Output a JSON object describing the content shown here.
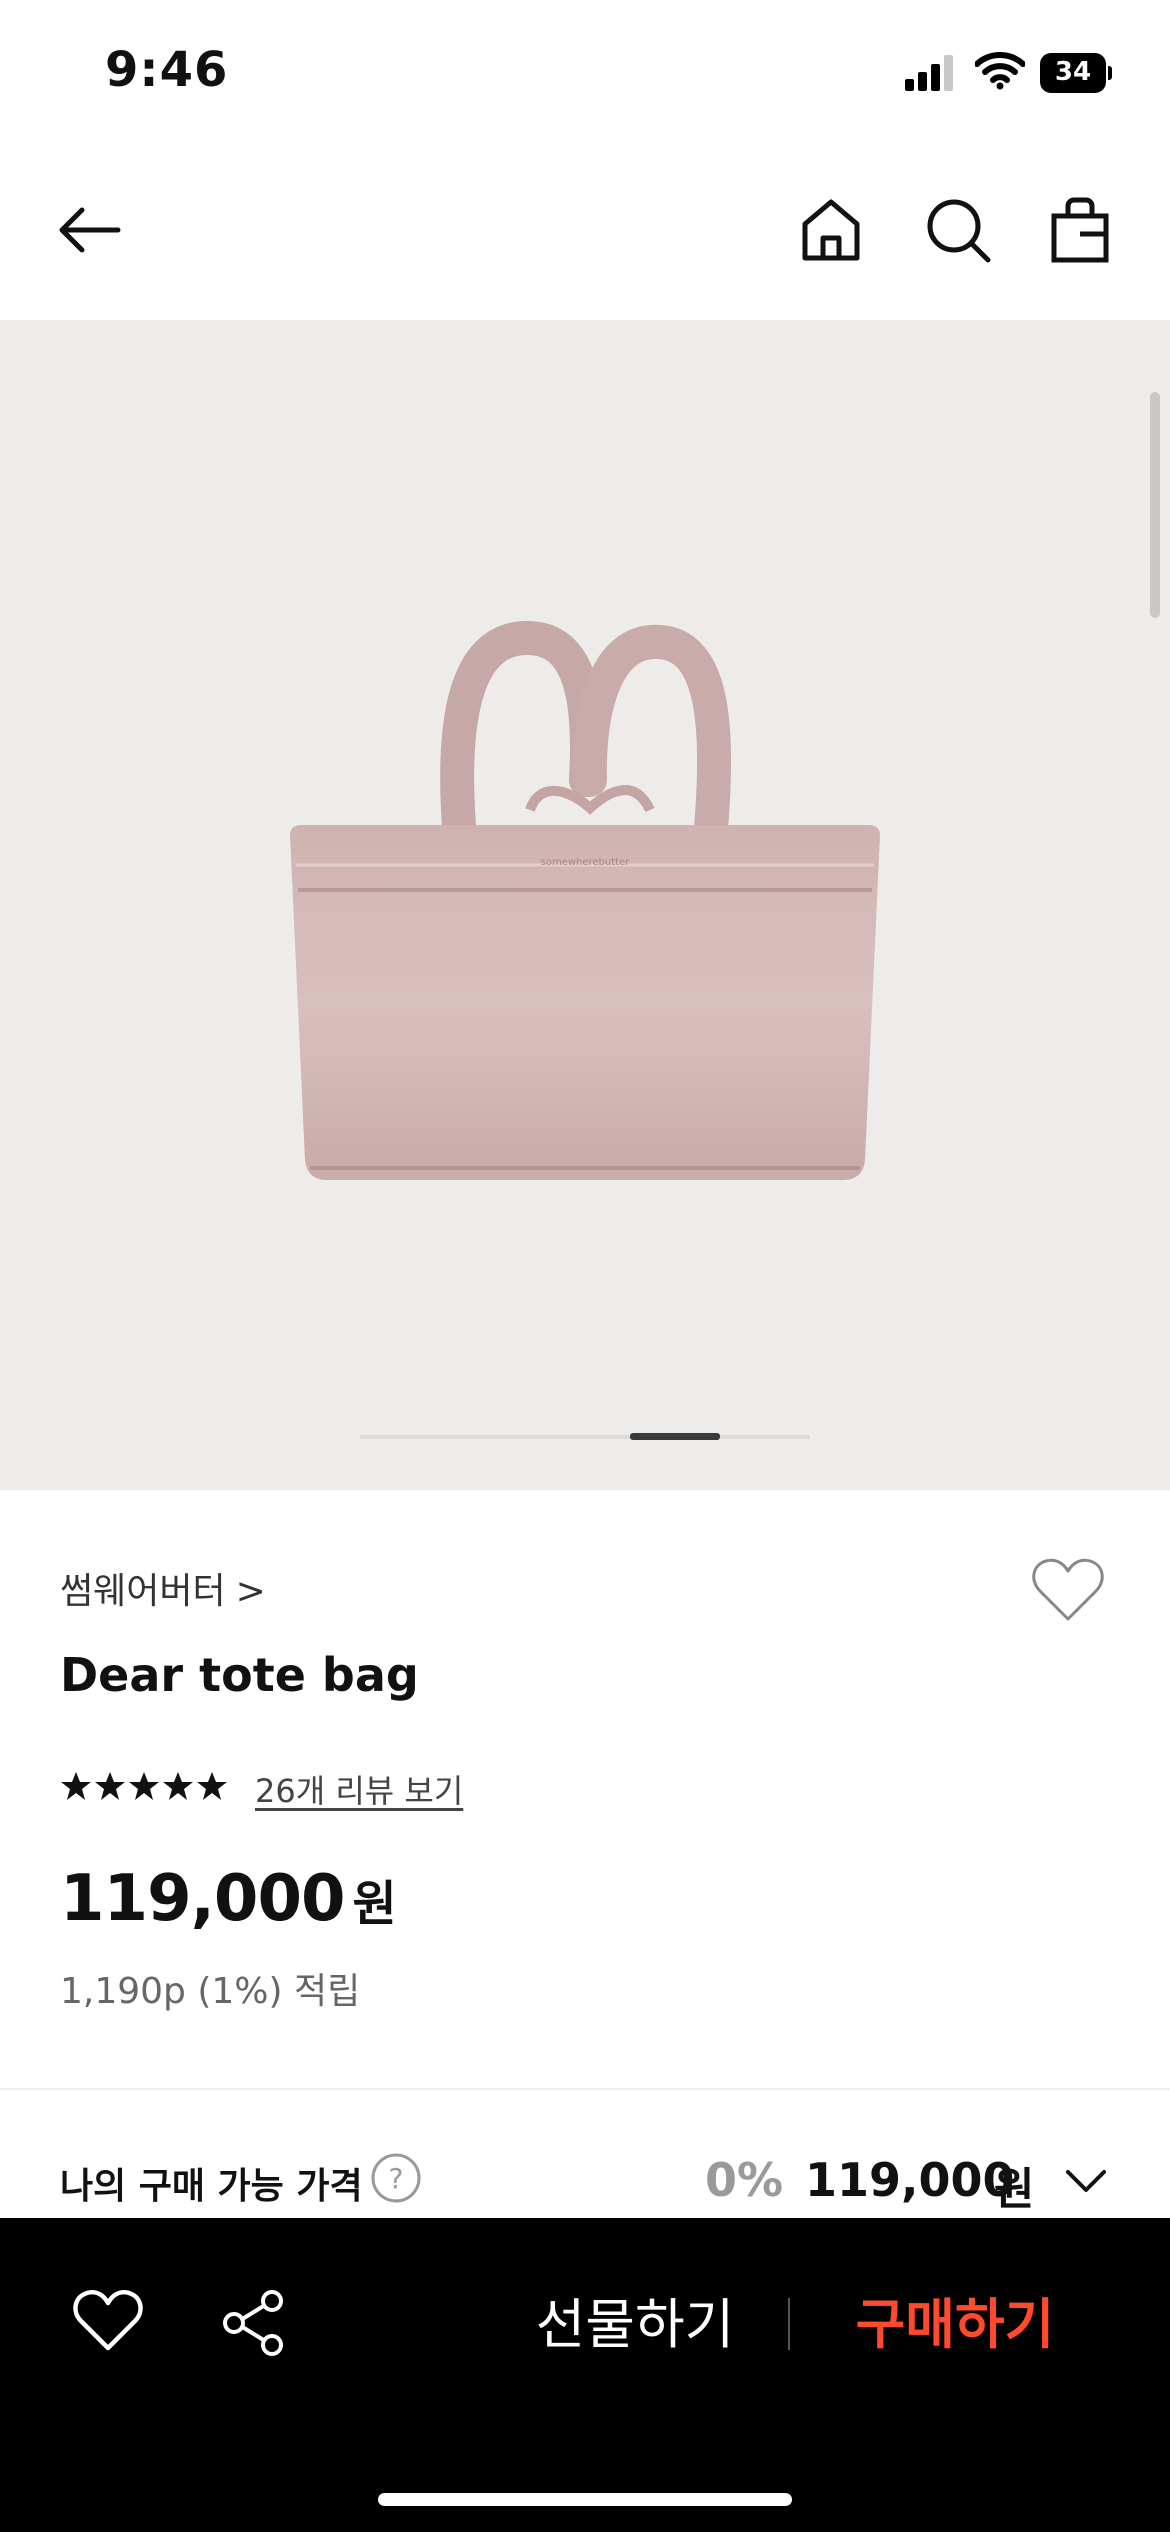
{
  "status_bar": {
    "time": "9:46",
    "battery": "34"
  },
  "top_nav": {
    "icons": [
      "back-arrow-icon",
      "home-icon",
      "search-icon",
      "shopping-bag-icon"
    ]
  },
  "gallery": {
    "image": "pink-tote-bag",
    "slide_progress": 0.6
  },
  "product": {
    "brand": "썸웨어버터",
    "brand_chevron": ">",
    "name": "Dear tote bag",
    "rating_stars": 5,
    "review_link": "26개 리뷰 보기",
    "price": "119,000",
    "price_unit": "원",
    "points": "1,190p (1%) 적립"
  },
  "my_price": {
    "label": "나의 구매 가능 가격",
    "discount": "0%",
    "price": "119,000",
    "unit": "원"
  },
  "bottom_bar": {
    "gift_label": "선물하기",
    "buy_label": "구매하기",
    "buy_color": "#ff4b2b"
  }
}
